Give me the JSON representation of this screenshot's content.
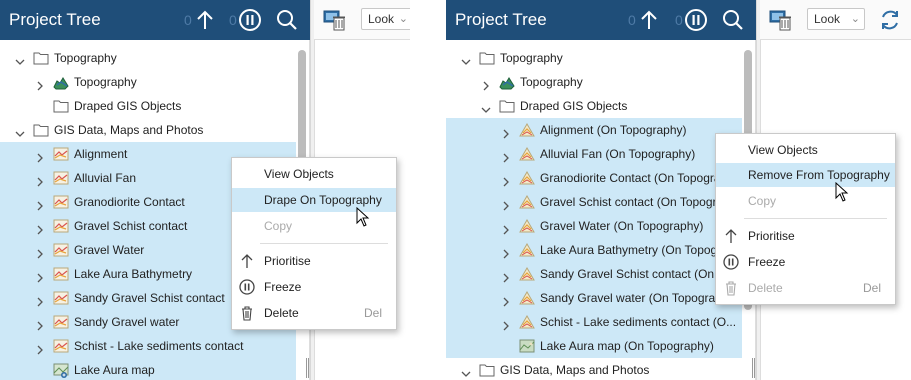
{
  "project_tree_title": "Project Tree",
  "header_count_a": "0",
  "header_count_b": "0",
  "look_label": "Look",
  "left": {
    "rows": [
      {
        "label": "Topography",
        "icon": "folder-icon",
        "chevron": "down",
        "selected": false
      },
      {
        "label": "Topography",
        "icon": "topography-icon",
        "chevron": "right",
        "selected": false
      },
      {
        "label": "Draped GIS Objects",
        "icon": "folder-icon",
        "chevron": "none",
        "selected": false
      },
      {
        "label": "GIS Data, Maps and Photos",
        "icon": "folder-icon",
        "chevron": "down",
        "selected": false
      },
      {
        "label": "Alignment",
        "icon": "gis-line-icon",
        "chevron": "right",
        "selected": true
      },
      {
        "label": "Alluvial Fan",
        "icon": "gis-line-icon",
        "chevron": "right",
        "selected": true
      },
      {
        "label": "Granodiorite Contact",
        "icon": "gis-line-icon",
        "chevron": "right",
        "selected": true
      },
      {
        "label": "Gravel Schist contact",
        "icon": "gis-line-icon",
        "chevron": "right",
        "selected": true
      },
      {
        "label": "Gravel Water",
        "icon": "gis-line-icon",
        "chevron": "right",
        "selected": true
      },
      {
        "label": "Lake Aura Bathymetry",
        "icon": "gis-line-icon",
        "chevron": "right",
        "selected": true
      },
      {
        "label": "Sandy Gravel Schist contact",
        "icon": "gis-line-icon",
        "chevron": "right",
        "selected": true
      },
      {
        "label": "Sandy Gravel water",
        "icon": "gis-line-icon",
        "chevron": "right",
        "selected": true
      },
      {
        "label": "Schist - Lake sediments contact",
        "icon": "gis-line-icon",
        "chevron": "right",
        "selected": true
      },
      {
        "label": "Lake Aura map",
        "icon": "map-image-icon",
        "chevron": "none",
        "selected": true
      }
    ],
    "menu": {
      "view_objects": "View Objects",
      "drape": "Drape On Topography",
      "copy": "Copy",
      "prioritise": "Prioritise",
      "freeze": "Freeze",
      "delete": "Delete",
      "delete_shortcut": "Del"
    }
  },
  "right": {
    "rows": [
      {
        "label": "Topography",
        "icon": "folder-icon",
        "chevron": "down",
        "selected": false
      },
      {
        "label": "Topography",
        "icon": "topography-icon",
        "chevron": "right",
        "selected": false
      },
      {
        "label": "Draped GIS Objects",
        "icon": "folder-icon",
        "chevron": "down",
        "selected": false
      },
      {
        "label": "Alignment (On Topography)",
        "icon": "draped-gis-icon",
        "chevron": "right",
        "selected": true
      },
      {
        "label": "Alluvial Fan (On Topography)",
        "icon": "draped-gis-icon",
        "chevron": "right",
        "selected": true
      },
      {
        "label": "Granodiorite Contact (On Topogra",
        "icon": "draped-gis-icon",
        "chevron": "right",
        "selected": true
      },
      {
        "label": "Gravel Schist contact (On Topogr",
        "icon": "draped-gis-icon",
        "chevron": "right",
        "selected": true
      },
      {
        "label": "Gravel Water (On Topography)",
        "icon": "draped-gis-icon",
        "chevron": "right",
        "selected": true
      },
      {
        "label": "Lake Aura Bathymetry (On Topog",
        "icon": "draped-gis-icon",
        "chevron": "right",
        "selected": true
      },
      {
        "label": "Sandy Gravel Schist contact (On T",
        "icon": "draped-gis-icon",
        "chevron": "right",
        "selected": true
      },
      {
        "label": "Sandy Gravel water (On Topograp",
        "icon": "draped-gis-icon",
        "chevron": "right",
        "selected": true
      },
      {
        "label": "Schist - Lake sediments contact (O...",
        "icon": "draped-gis-icon",
        "chevron": "right",
        "selected": true
      },
      {
        "label": "Lake Aura map (On Topography)",
        "icon": "draped-map-icon",
        "chevron": "none",
        "selected": true
      },
      {
        "label": "GIS Data, Maps and Photos",
        "icon": "folder-icon",
        "chevron": "down",
        "selected": false
      }
    ],
    "menu": {
      "view_objects": "View Objects",
      "remove": "Remove From Topography",
      "copy": "Copy",
      "prioritise": "Prioritise",
      "freeze": "Freeze",
      "delete": "Delete",
      "delete_shortcut": "Del"
    }
  },
  "colors": {
    "header_bg": "#1f4e79",
    "selection": "#cde8f7",
    "header_count": "#4f7ba6"
  }
}
